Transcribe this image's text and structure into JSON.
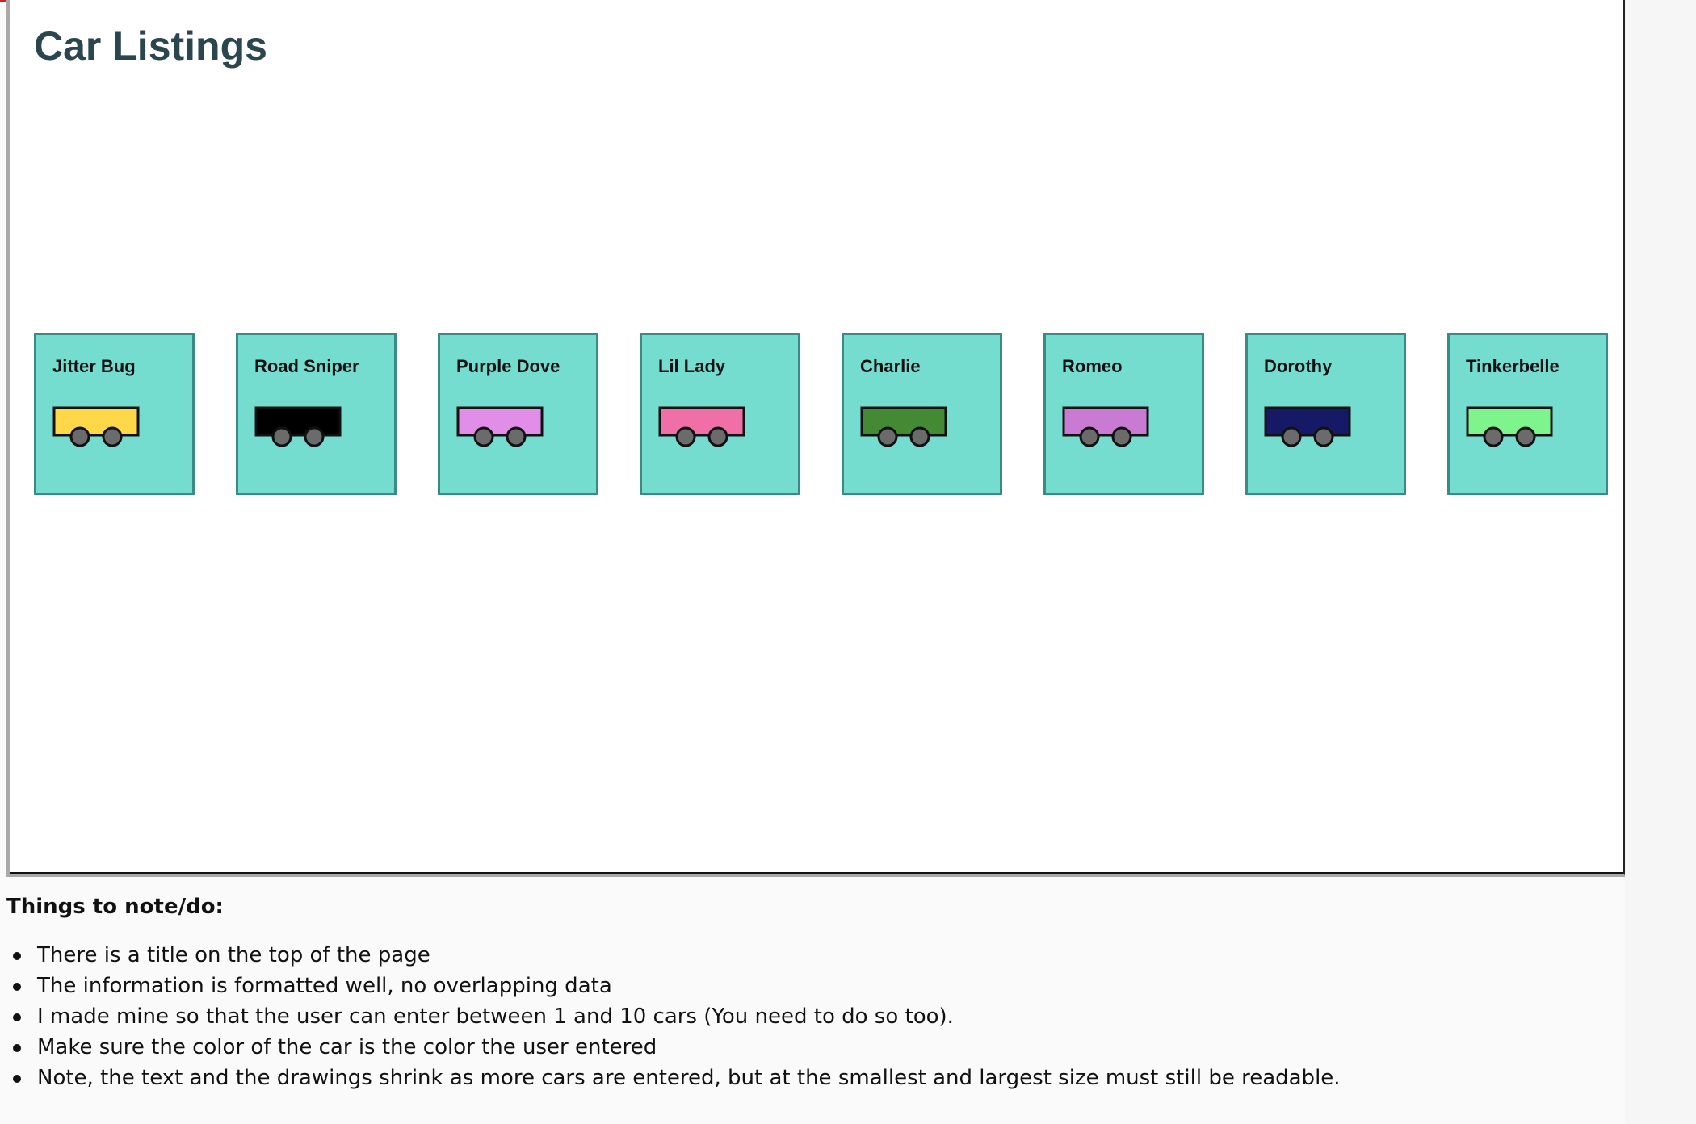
{
  "canvas": {
    "title": "Car Listings",
    "cars": [
      {
        "name": "Jitter Bug",
        "color": "#ffd84a"
      },
      {
        "name": "Road Sniper",
        "color": "#000000"
      },
      {
        "name": "Purple Dove",
        "color": "#e18ee8"
      },
      {
        "name": "Lil Lady",
        "color": "#ef6fa6"
      },
      {
        "name": "Charlie",
        "color": "#448a35"
      },
      {
        "name": "Romeo",
        "color": "#c97bd4"
      },
      {
        "name": "Dorothy",
        "color": "#161a66"
      },
      {
        "name": "Tinkerbelle",
        "color": "#7df48c"
      }
    ],
    "card_color": "#75ddd0",
    "wheel_color": "#6b6b6b"
  },
  "notes": {
    "heading": "Things to note/do:",
    "items": [
      "There is a title on the top of the page",
      "The information is formatted well, no overlapping data",
      "I made mine so that the user can enter between 1 and 10 cars (You need to do so too).",
      "Make sure the color of the car is the color the user entered",
      "Note, the text and the drawings shrink as more cars are entered, but at the smallest and largest size must still be readable."
    ]
  }
}
